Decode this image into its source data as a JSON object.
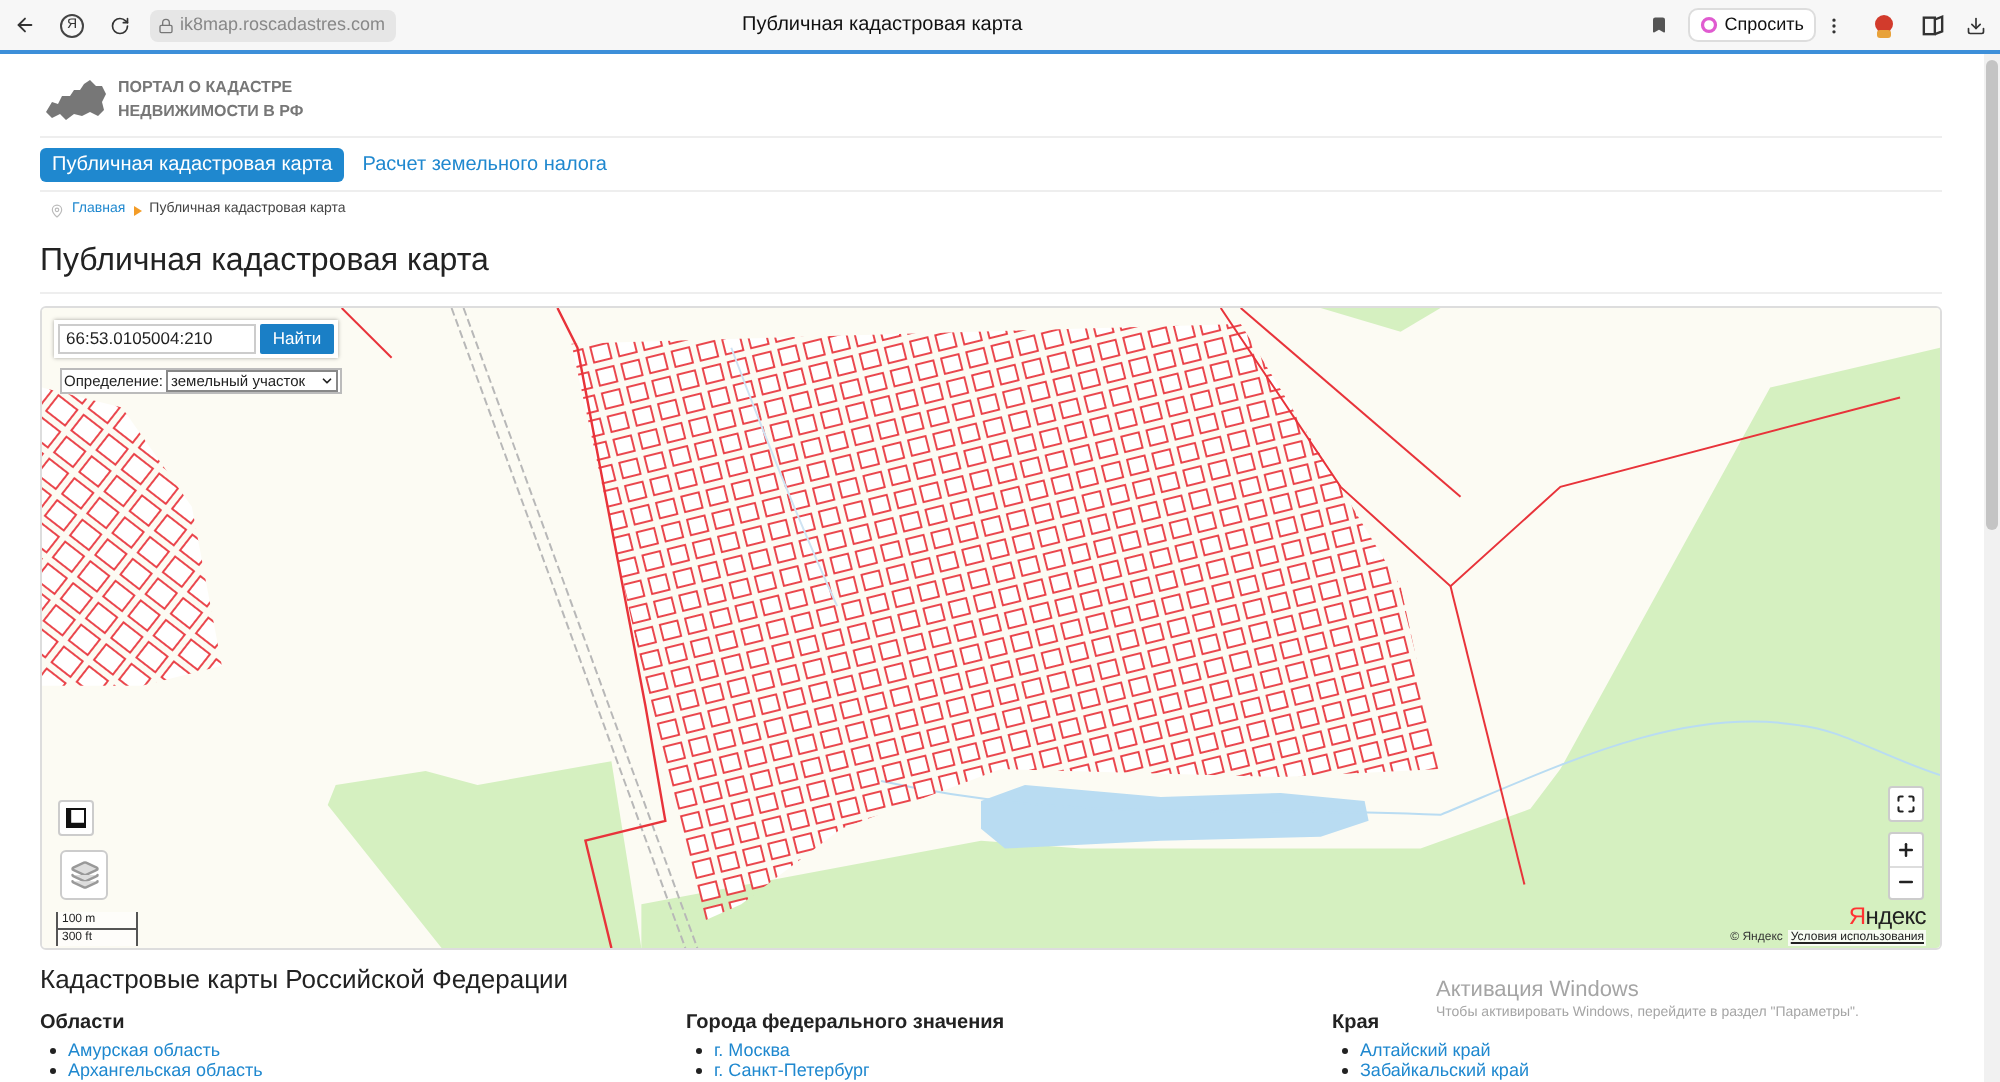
{
  "browser": {
    "home_button": "Я",
    "url": "ik8map.roscadastres.com",
    "tab_title": "Публичная кадастровая карта",
    "ask_button": "Спросить"
  },
  "header": {
    "logo_lines": [
      "ПОРТАЛ О КАДАСТРЕ",
      "НЕДВИЖИМОСТИ В РФ"
    ]
  },
  "nav": [
    {
      "label": "Публичная кадастровая карта",
      "selected": true
    },
    {
      "label": "Расчет земельного налога",
      "selected": false
    }
  ],
  "breadcrumbs": [
    {
      "label": "Главная",
      "kind": "link"
    },
    {
      "label": "Публичная кадастровая карта",
      "kind": "current"
    }
  ],
  "page_title": "Публичная кадастровая карта",
  "map": {
    "search": {
      "value": "66:53.0105004:210",
      "button": "Найти"
    },
    "definition": {
      "label": "Определение:",
      "value": "земельный участок"
    },
    "scale": [
      "100 m",
      "300 ft"
    ],
    "provider_logo": "Яндекс",
    "copyright": "© Яндекс",
    "terms_link": "Условия использования"
  },
  "regions": {
    "title": "Кадастровые карты Российской Федерации",
    "columns": [
      {
        "heading": "Области",
        "items": [
          "Амурская область",
          "Архангельская область"
        ]
      },
      {
        "heading": "Города федерального значения",
        "items": [
          "г. Москва",
          "г. Санкт-Петербург"
        ]
      },
      {
        "heading": "Края",
        "items": [
          "Алтайский край",
          "Забайкальский край"
        ]
      }
    ]
  },
  "windows_notice": {
    "title": "Активация Windows",
    "text": "Чтобы активировать Windows, перейдите в раздел \"Параметры\"."
  }
}
